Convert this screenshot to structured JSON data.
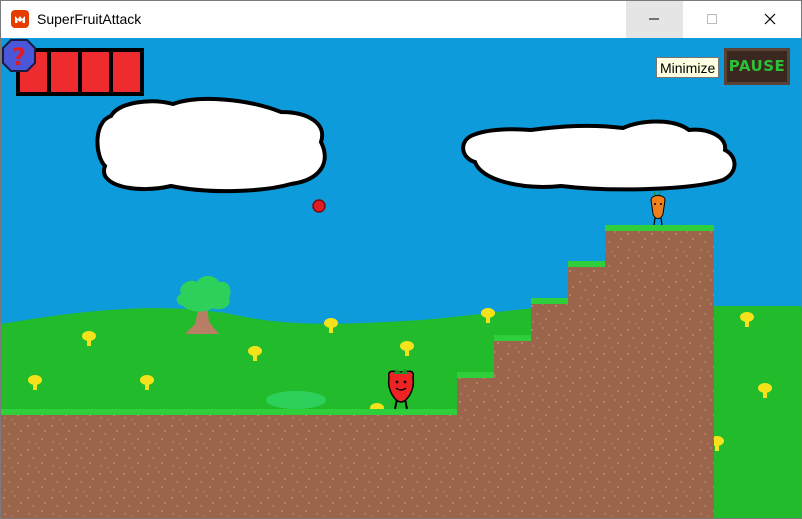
{
  "window": {
    "title": "SuperFruitAttack",
    "controls": [
      "minimize",
      "maximize",
      "close"
    ]
  },
  "tooltip": {
    "text": "Minimize"
  },
  "hud": {
    "health_segments": 4,
    "health_color": "#ee2b2f",
    "pause_label": "PAUSE",
    "help_label": "?"
  },
  "scene": {
    "sky_color": "#0d9bdc",
    "hill_color": "#22bb2b",
    "ground_color": "#9a654b",
    "player": "strawberry",
    "enemy": "carrot",
    "projectile": "red-ball"
  }
}
